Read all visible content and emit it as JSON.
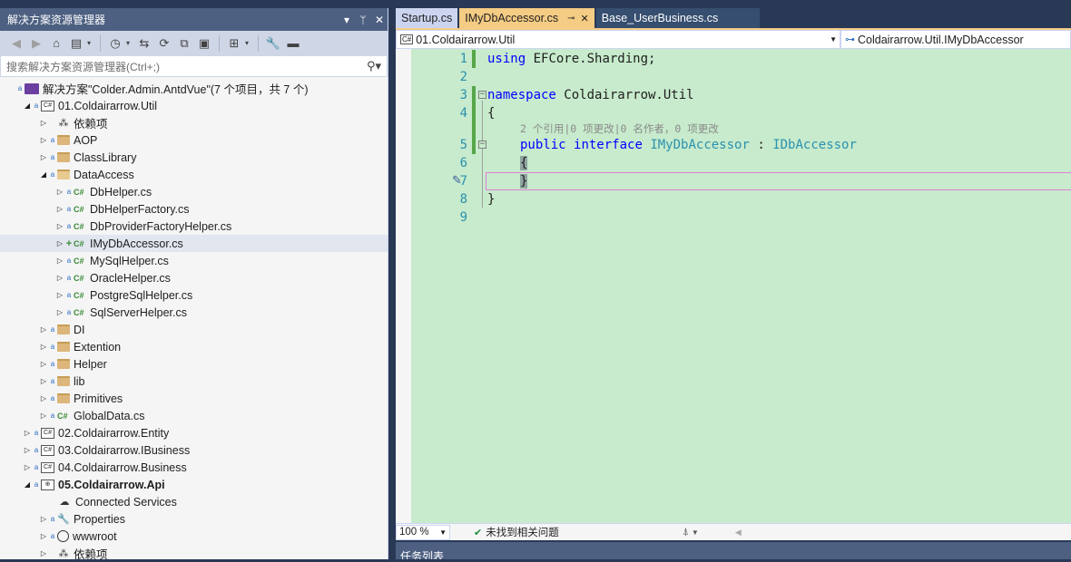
{
  "solution_explorer": {
    "title": "解决方案资源管理器",
    "title_buttons": [
      "▾",
      "ᛘ",
      "✕"
    ],
    "search_placeholder": "搜索解决方案资源管理器(Ctrl+;)",
    "tree": [
      {
        "label": "解决方案\"Colder.Admin.AntdVue\"(7 个项目，共 7 个)",
        "icon": "solution-icon",
        "indent": 0,
        "exp": "",
        "lock": "a",
        "bold": false
      },
      {
        "label": "01.Coldairarrow.Util",
        "icon": "csharp-project-icon",
        "indent": 1,
        "exp": "◢",
        "lock": "a"
      },
      {
        "label": "依赖项",
        "icon": "dependencies-icon",
        "indent": 2,
        "exp": "▷",
        "lock": ""
      },
      {
        "label": "AOP",
        "icon": "folder-icon",
        "indent": 2,
        "exp": "▷",
        "lock": "a"
      },
      {
        "label": "ClassLibrary",
        "icon": "folder-icon",
        "indent": 2,
        "exp": "▷",
        "lock": "a"
      },
      {
        "label": "DataAccess",
        "icon": "folder-open-icon",
        "indent": 2,
        "exp": "◢",
        "lock": "a"
      },
      {
        "label": "DbHelper.cs",
        "icon": "csharp-file-icon",
        "indent": 3,
        "exp": "▷",
        "lock": "a"
      },
      {
        "label": "DbHelperFactory.cs",
        "icon": "csharp-file-icon",
        "indent": 3,
        "exp": "▷",
        "lock": "a"
      },
      {
        "label": "DbProviderFactoryHelper.cs",
        "icon": "csharp-file-icon",
        "indent": 3,
        "exp": "▷",
        "lock": "a"
      },
      {
        "label": "IMyDbAccessor.cs",
        "icon": "csharp-file-icon",
        "indent": 3,
        "exp": "▷",
        "lock": "+",
        "selected": true
      },
      {
        "label": "MySqlHelper.cs",
        "icon": "csharp-file-icon",
        "indent": 3,
        "exp": "▷",
        "lock": "a"
      },
      {
        "label": "OracleHelper.cs",
        "icon": "csharp-file-icon",
        "indent": 3,
        "exp": "▷",
        "lock": "a"
      },
      {
        "label": "PostgreSqlHelper.cs",
        "icon": "csharp-file-icon",
        "indent": 3,
        "exp": "▷",
        "lock": "a"
      },
      {
        "label": "SqlServerHelper.cs",
        "icon": "csharp-file-icon",
        "indent": 3,
        "exp": "▷",
        "lock": "a"
      },
      {
        "label": "DI",
        "icon": "folder-icon",
        "indent": 2,
        "exp": "▷",
        "lock": "a"
      },
      {
        "label": "Extention",
        "icon": "folder-icon",
        "indent": 2,
        "exp": "▷",
        "lock": "a"
      },
      {
        "label": "Helper",
        "icon": "folder-icon",
        "indent": 2,
        "exp": "▷",
        "lock": "a"
      },
      {
        "label": "lib",
        "icon": "folder-icon",
        "indent": 2,
        "exp": "▷",
        "lock": "a"
      },
      {
        "label": "Primitives",
        "icon": "folder-icon",
        "indent": 2,
        "exp": "▷",
        "lock": "a"
      },
      {
        "label": "GlobalData.cs",
        "icon": "csharp-file-icon",
        "indent": 2,
        "exp": "▷",
        "lock": "a"
      },
      {
        "label": "02.Coldairarrow.Entity",
        "icon": "csharp-project-icon",
        "indent": 1,
        "exp": "▷",
        "lock": "a"
      },
      {
        "label": "03.Coldairarrow.IBusiness",
        "icon": "csharp-project-icon",
        "indent": 1,
        "exp": "▷",
        "lock": "a"
      },
      {
        "label": "04.Coldairarrow.Business",
        "icon": "csharp-project-icon",
        "indent": 1,
        "exp": "▷",
        "lock": "a"
      },
      {
        "label": "05.Coldairarrow.Api",
        "icon": "web-project-icon",
        "indent": 1,
        "exp": "◢",
        "lock": "a",
        "bold": true
      },
      {
        "label": "Connected Services",
        "icon": "connected-services-icon",
        "indent": 2,
        "exp": "",
        "lock": ""
      },
      {
        "label": "Properties",
        "icon": "properties-icon",
        "indent": 2,
        "exp": "▷",
        "lock": "a"
      },
      {
        "label": "wwwroot",
        "icon": "globe-icon",
        "indent": 2,
        "exp": "▷",
        "lock": "a"
      },
      {
        "label": "依赖项",
        "icon": "dependencies-icon",
        "indent": 2,
        "exp": "▷",
        "lock": ""
      }
    ]
  },
  "tabs": [
    {
      "label": "Startup.cs",
      "state": "inactive"
    },
    {
      "label": "IMyDbAccessor.cs",
      "state": "active",
      "pin": "⊸",
      "close": "✕"
    },
    {
      "label": "Base_UserBusiness.cs",
      "state": "blue"
    }
  ],
  "navbar": {
    "project": "01.Coldairarrow.Util",
    "project_badge": "C#",
    "member": "Coldairarrow.Util.IMyDbAccessor",
    "member_icon": "⊶"
  },
  "editor": {
    "line_numbers": [
      "1",
      "2",
      "3",
      "4",
      "5",
      "6",
      "7",
      "8",
      "9"
    ],
    "codelens": "2 个引用|0 项更改|0 名作者，0 项更改",
    "lines": {
      "l1_kw": "using",
      "l1_rest": " EFCore.Sharding;",
      "l3_kw": "namespace",
      "l3_rest": " Coldairarrow.Util",
      "l4": "{",
      "l5_kw1": "public",
      "l5_kw2": "interface",
      "l5_type1": "IMyDbAccessor",
      "l5_colon": " : ",
      "l5_type2": "IDbAccessor",
      "l6": "{",
      "l7": "}",
      "l8": "}"
    },
    "fold_collapse_glyph": "−"
  },
  "statusbar": {
    "zoom": "100 %",
    "issues": "未找到相关问题",
    "issues_icon": "✔"
  },
  "bottom_panel": {
    "title": "任务列表"
  },
  "colors": {
    "title_bar": "#4d6082",
    "editor_bg": "#c7ebcc",
    "active_tab": "#f5cc84",
    "keyword": "#0000ff",
    "type": "#2b91af",
    "line_number": "#2b91af",
    "change_bar": "#57a64a",
    "current_line": "#e37dd8"
  }
}
